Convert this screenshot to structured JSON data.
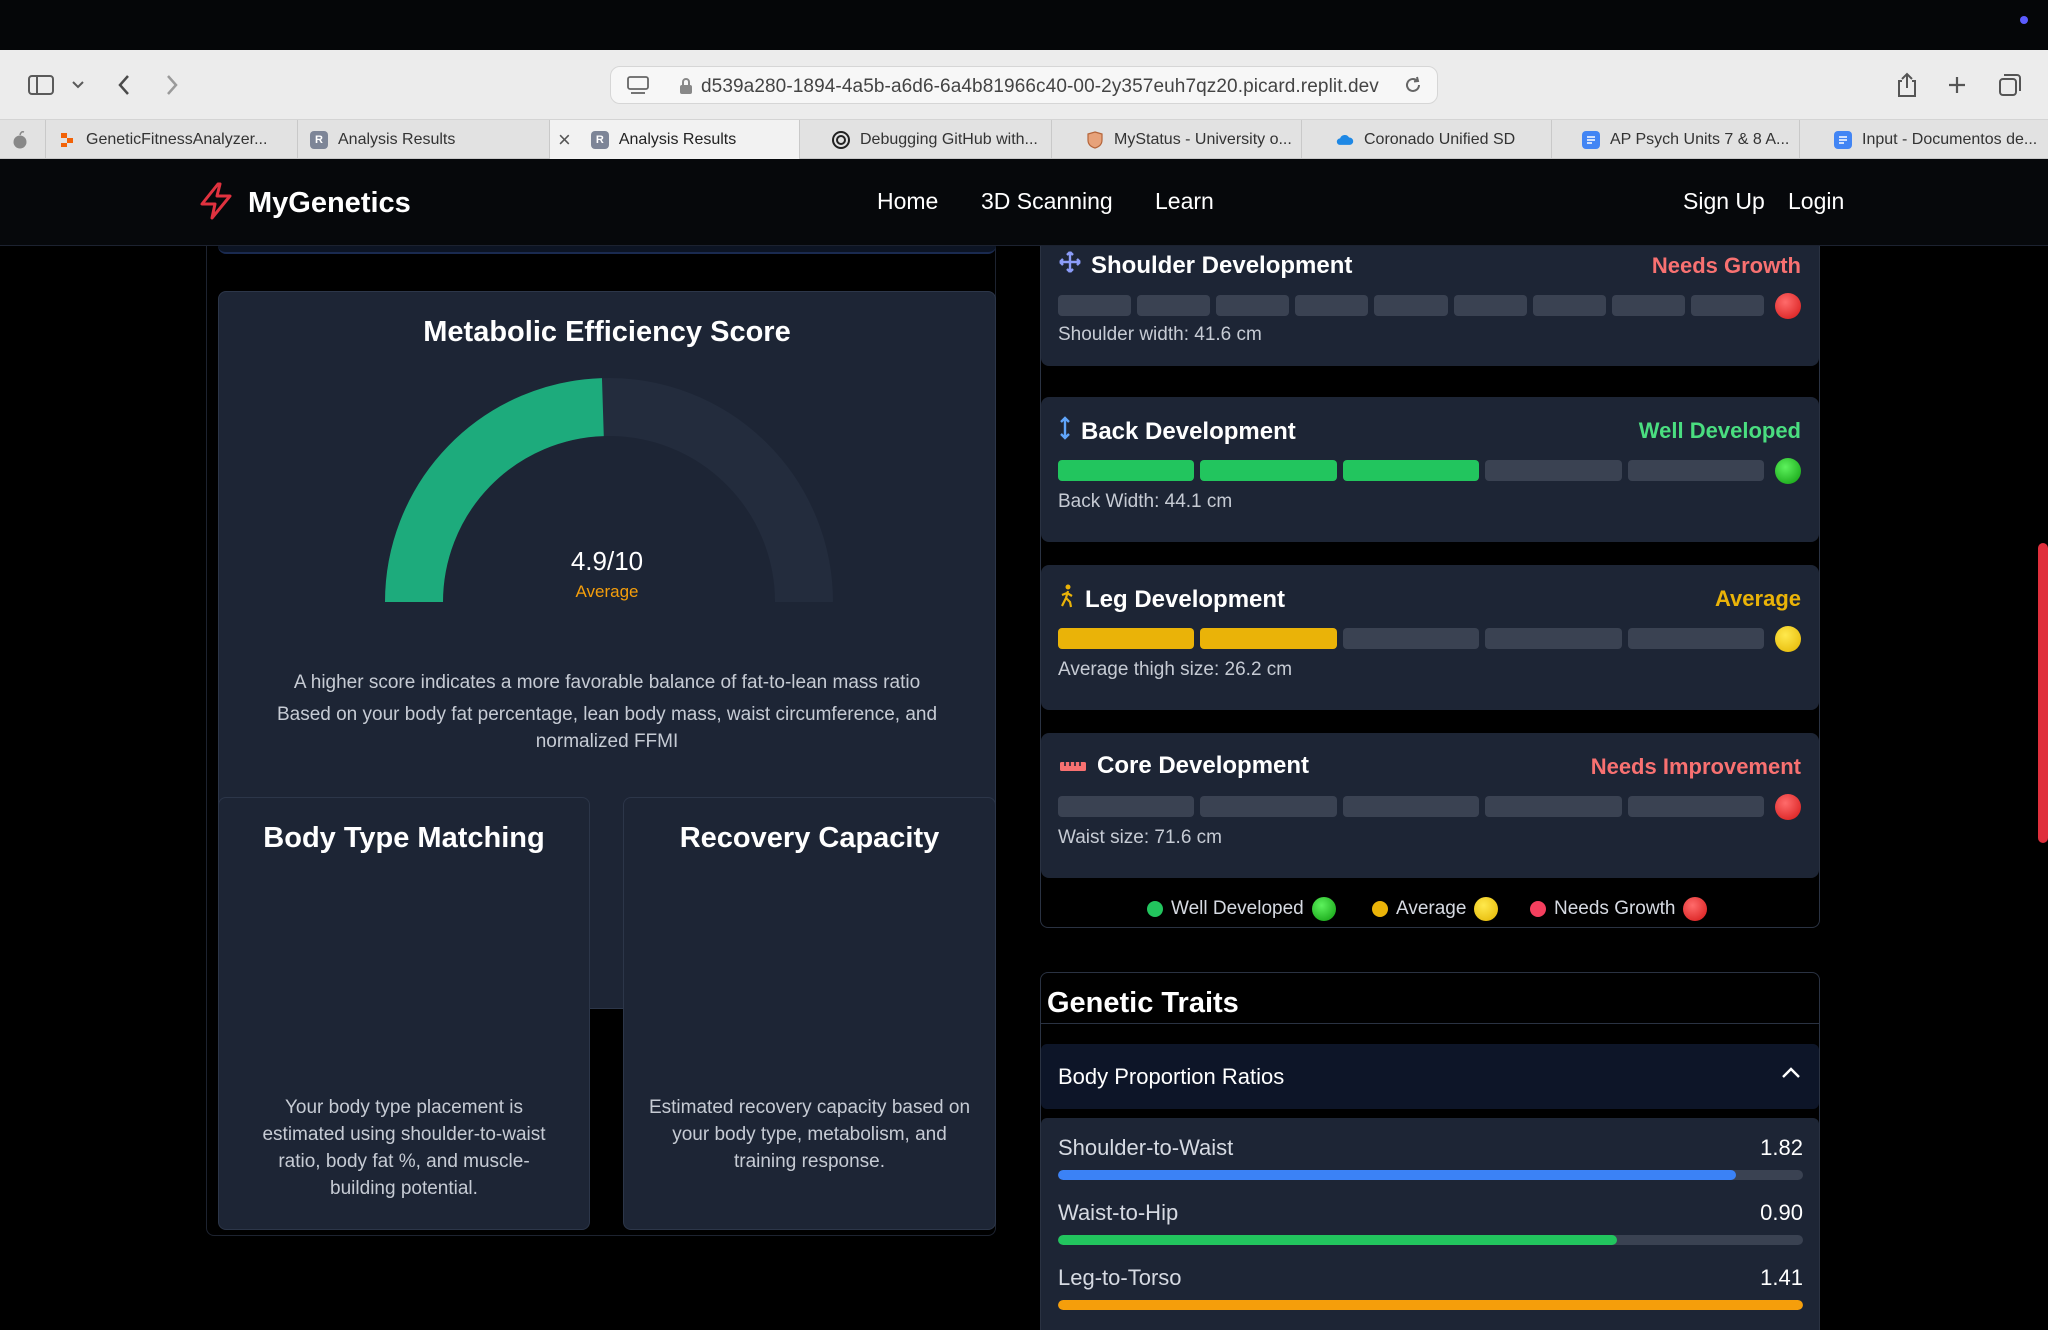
{
  "browser": {
    "url": "d539a280-1894-4a5b-a6d6-6a4b81966c40-00-2y357euh7qz20.picard.replit.dev",
    "tabs": [
      {
        "label": "GeneticFitnessAnalyzer...",
        "favicon": "replit-icon",
        "color": "#f26207"
      },
      {
        "label": "Analysis Results",
        "favicon": "R",
        "color": "#7d8597"
      },
      {
        "label": "Analysis Results",
        "favicon": "R",
        "color": "#7d8597"
      },
      {
        "label": "Debugging GitHub with...",
        "favicon": "openai-icon",
        "color": "#222222"
      },
      {
        "label": "MyStatus - University o...",
        "favicon": "shield-icon",
        "color": "#b5653a"
      },
      {
        "label": "Coronado Unified SD",
        "favicon": "cloud-icon",
        "color": "#1e88e5"
      },
      {
        "label": "AP Psych Units 7 & 8 A...",
        "favicon": "docs-icon",
        "color": "#4285f4"
      },
      {
        "label": "Input - Documentos de...",
        "favicon": "docs-icon",
        "color": "#4285f4"
      }
    ]
  },
  "site": {
    "brand": "MyGenetics",
    "brand_color": "#e0323f",
    "nav": {
      "home": "Home",
      "scanning": "3D Scanning",
      "learn": "Learn",
      "signup": "Sign Up",
      "login": "Login"
    }
  },
  "metabolic": {
    "title": "Metabolic Efficiency Score",
    "score": "4.9/10",
    "score_value": 4.9,
    "rating": "Average",
    "desc1": "A higher score indicates a more favorable balance of fat-to-lean mass ratio",
    "desc2": "Based on your body fat percentage, lean body mass, waist circumference, and normalized FFMI",
    "gauge_color": "#1dab7c"
  },
  "body_type": {
    "title": "Body Type Matching",
    "desc": "Your body type placement is estimated using shoulder-to-waist ratio, body fat %, and muscle-building potential."
  },
  "recovery": {
    "title": "Recovery Capacity",
    "desc": "Estimated recovery capacity based on your body type, metabolism, and training response."
  },
  "development": {
    "shoulder": {
      "title": "Shoulder Development",
      "status": "Needs Growth",
      "measure": "Shoulder width: 41.6 cm",
      "filled": 0,
      "segments": 9,
      "icon": "move-icon"
    },
    "back": {
      "title": "Back Development",
      "status": "Well Developed",
      "measure": "Back Width: 44.1 cm",
      "filled": 3,
      "segments": 5,
      "icon": "vertical-arrows-icon"
    },
    "leg": {
      "title": "Leg Development",
      "status": "Average",
      "measure": "Average thigh size: 26.2 cm",
      "filled": 2,
      "segments": 5,
      "icon": "walking-icon"
    },
    "core": {
      "title": "Core Development",
      "status": "Needs Improvement",
      "measure": "Waist size: 71.6 cm",
      "filled": 0,
      "segments": 5,
      "icon": "ruler-icon"
    }
  },
  "legend": {
    "well": "Well Developed",
    "average": "Average",
    "needs": "Needs Growth"
  },
  "colors": {
    "green": "#22c55e",
    "yellow": "#eab308",
    "red": "#f87171",
    "blue": "#3b82f6",
    "orange": "#f59e0b"
  },
  "genetic": {
    "title": "Genetic Traits",
    "accordion": "Body Proportion Ratios",
    "ratios": [
      {
        "label": "Shoulder-to-Waist",
        "value": "1.82",
        "fill_pct": 91
      },
      {
        "label": "Waist-to-Hip",
        "value": "0.90",
        "fill_pct": 75
      },
      {
        "label": "Leg-to-Torso",
        "value": "1.41",
        "fill_pct": 100
      }
    ]
  }
}
